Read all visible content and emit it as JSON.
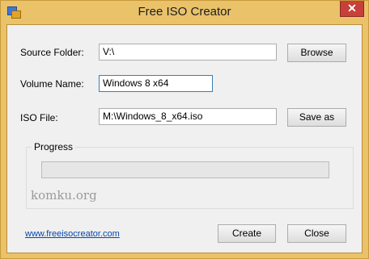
{
  "window": {
    "title": "Free ISO Creator",
    "close_glyph": "✕"
  },
  "form": {
    "source_folder_label": "Source Folder:",
    "source_folder_value": "V:\\",
    "browse_label": "Browse",
    "volume_name_label": "Volume Name:",
    "volume_name_value": "Windows 8 x64",
    "iso_file_label": "ISO File:",
    "iso_file_value": "M:\\Windows_8_x64.iso",
    "save_as_label": "Save as"
  },
  "progress": {
    "group_label": "Progress",
    "value": 0
  },
  "watermark": "komku.org",
  "footer": {
    "website_link": "www.freeisocreator.com",
    "create_label": "Create",
    "close_label": "Close"
  },
  "colors": {
    "title_frame": "#e9c26a",
    "client_bg": "#f0f0f0",
    "link": "#0645ad",
    "close_button": "#c7403a"
  }
}
